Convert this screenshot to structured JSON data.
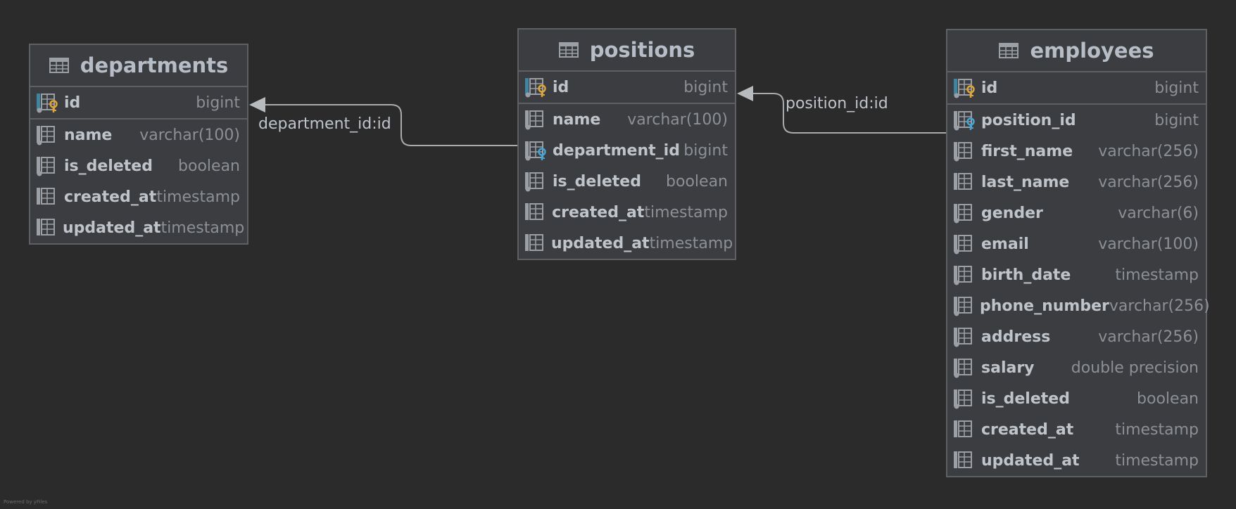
{
  "tables": {
    "departments": {
      "title": "departments",
      "columns": [
        {
          "name": "id",
          "type": "bigint",
          "icon": "primary-key-icon"
        },
        {
          "name": "name",
          "type": "varchar(100)",
          "icon": "column-dot-icon"
        },
        {
          "name": "is_deleted",
          "type": "boolean",
          "icon": "column-dot-icon"
        },
        {
          "name": "created_at",
          "type": "timestamp",
          "icon": "column-icon"
        },
        {
          "name": "updated_at",
          "type": "timestamp",
          "icon": "column-icon"
        }
      ]
    },
    "positions": {
      "title": "positions",
      "columns": [
        {
          "name": "id",
          "type": "bigint",
          "icon": "primary-key-icon"
        },
        {
          "name": "name",
          "type": "varchar(100)",
          "icon": "column-dot-icon"
        },
        {
          "name": "department_id",
          "type": "bigint",
          "icon": "foreign-key-icon"
        },
        {
          "name": "is_deleted",
          "type": "boolean",
          "icon": "column-dot-icon"
        },
        {
          "name": "created_at",
          "type": "timestamp",
          "icon": "column-icon"
        },
        {
          "name": "updated_at",
          "type": "timestamp",
          "icon": "column-icon"
        }
      ]
    },
    "employees": {
      "title": "employees",
      "columns": [
        {
          "name": "id",
          "type": "bigint",
          "icon": "primary-key-icon"
        },
        {
          "name": "position_id",
          "type": "bigint",
          "icon": "foreign-key-icon"
        },
        {
          "name": "first_name",
          "type": "varchar(256)",
          "icon": "column-dot-icon"
        },
        {
          "name": "last_name",
          "type": "varchar(256)",
          "icon": "column-icon"
        },
        {
          "name": "gender",
          "type": "varchar(6)",
          "icon": "column-dot-icon"
        },
        {
          "name": "email",
          "type": "varchar(100)",
          "icon": "column-dot-icon"
        },
        {
          "name": "birth_date",
          "type": "timestamp",
          "icon": "column-dot-icon"
        },
        {
          "name": "phone_number",
          "type": "varchar(256)",
          "icon": "column-dot-icon"
        },
        {
          "name": "address",
          "type": "varchar(256)",
          "icon": "column-dot-icon"
        },
        {
          "name": "salary",
          "type": "double precision",
          "icon": "column-dot-icon"
        },
        {
          "name": "is_deleted",
          "type": "boolean",
          "icon": "column-dot-icon"
        },
        {
          "name": "created_at",
          "type": "timestamp",
          "icon": "column-icon"
        },
        {
          "name": "updated_at",
          "type": "timestamp",
          "icon": "column-icon"
        }
      ]
    }
  },
  "relations": {
    "department": "department_id:id",
    "position": "position_id:id"
  },
  "footer": "Powered by yFiles",
  "colors": {
    "background": "#2b2b2b",
    "table_bg": "#3b3d40",
    "border": "#5e6063",
    "key_gold": "#e2a532",
    "key_blue": "#3fa6d6",
    "icon_teal": "#3e86a0",
    "icon_gray": "#9aa0a6"
  }
}
